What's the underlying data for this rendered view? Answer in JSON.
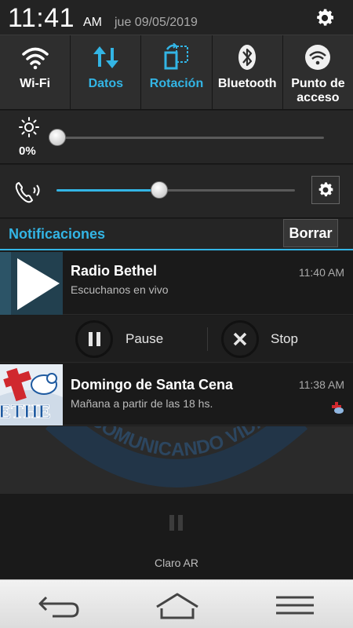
{
  "status": {
    "time": "11:41",
    "ampm": "AM",
    "date": "jue 09/05/2019"
  },
  "quick_toggles": [
    {
      "label": "Wi-Fi",
      "icon": "wifi-icon",
      "active": false
    },
    {
      "label": "Datos",
      "icon": "data-arrows-icon",
      "active": true
    },
    {
      "label": "Rotación",
      "icon": "rotation-icon",
      "active": true
    },
    {
      "label": "Bluetooth",
      "icon": "bluetooth-icon",
      "active": false
    },
    {
      "label": "Punto de acceso",
      "icon": "hotspot-icon",
      "active": false
    }
  ],
  "brightness": {
    "label": "0%",
    "level": 0.0
  },
  "volume": {
    "level": 0.43
  },
  "notifications_header": {
    "title": "Notificaciones",
    "clear_label": "Borrar"
  },
  "notifications": [
    {
      "app": "Radio Bethel",
      "text": "Escuchanos en vivo",
      "time": "11:40 AM",
      "actions": [
        {
          "label": "Pause",
          "icon": "pause-icon"
        },
        {
          "label": "Stop",
          "icon": "stop-icon"
        }
      ]
    },
    {
      "app": "Domingo de Santa Cena",
      "text": "Mañana a partir de las 18 hs.",
      "time": "11:38 AM",
      "icon_text": "ETHE"
    }
  ],
  "background": {
    "watermark": "COMUNICANDO VIDA"
  },
  "carrier": "Claro AR",
  "colors": {
    "accent": "#33b5e5",
    "panel": "#2e2e2e",
    "background": "#1c1c1c"
  }
}
